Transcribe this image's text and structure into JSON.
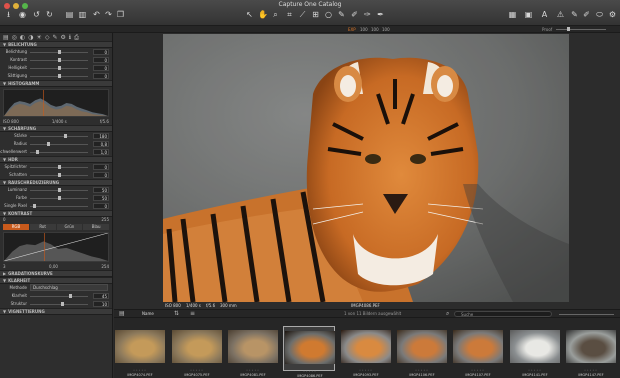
{
  "window": {
    "title": "Capture One Catalog"
  },
  "colors": {
    "accent": "#c85a1c",
    "panel": "#2e2e2e",
    "toolbar": "#3a3a3a"
  },
  "toolbar": {
    "left_icons": [
      "import-icon",
      "capture-icon",
      "rotate-left-icon",
      "rotate-right-icon",
      "folder-icon",
      "copy-icon",
      "undo-icon",
      "redo-icon",
      "stack-icon"
    ],
    "center_icons": [
      "select-icon",
      "pan-icon",
      "zoom-icon",
      "crop-icon",
      "straighten-icon",
      "keystone-icon",
      "spot-icon",
      "picker-icon",
      "brush-icon",
      "eraser-icon",
      "gradient-icon"
    ],
    "right_icons": [
      "grid-icon",
      "proof-icon",
      "text-icon",
      "alert-icon",
      "copy-adjust-icon",
      "apply-adjust-icon",
      "viewer-icon",
      "settings-icon"
    ]
  },
  "viewer_modes": [
    "EXP",
    "100",
    "100",
    "100"
  ],
  "zoom_label": "Proof",
  "sidebar": {
    "sections": {
      "exposure": "BELICHTUNG",
      "histogram": "HISTOGRAMM",
      "sharpening": "SCHÄRFUNG",
      "hdr": "HDR",
      "noise": "RAUSCHREDUZIERUNG",
      "curve": "KONTRAST",
      "gradation": "GRADATIONSKURVE",
      "clarity": "KLARHEIT",
      "vignetting": "VIGNETTIERUNG"
    },
    "exposure_rows": [
      {
        "label": "Belichtung",
        "value": "0",
        "pos": 0.5
      },
      {
        "label": "Kontrast",
        "value": "0",
        "pos": 0.5
      },
      {
        "label": "Helligkeit",
        "value": "0",
        "pos": 0.5
      },
      {
        "label": "Sättigung",
        "value": "0",
        "pos": 0.5
      }
    ],
    "histogram_info": {
      "iso": "ISO 800",
      "shutter": "1/400 s",
      "aperture": "f/5.6"
    },
    "sharpening_rows": [
      {
        "label": "Stärke",
        "value": "180",
        "pos": 0.6
      },
      {
        "label": "Radius",
        "value": "0,8",
        "pos": 0.3
      },
      {
        "label": "Schwellenwert",
        "value": "1,0",
        "pos": 0.1
      }
    ],
    "hdr_rows": [
      {
        "label": "Spitzlichter",
        "value": "0",
        "pos": 0.5
      },
      {
        "label": "Schatten",
        "value": "0",
        "pos": 0.5
      }
    ],
    "noise_rows": [
      {
        "label": "Luminanz",
        "value": "50",
        "pos": 0.5
      },
      {
        "label": "Farbe",
        "value": "50",
        "pos": 0.5
      },
      {
        "label": "Single Pixel",
        "value": "0",
        "pos": 0.05
      }
    ],
    "curve": {
      "input_label": "0",
      "max_label": "255",
      "tabs": [
        "RGB",
        "Rot",
        "Grün",
        "Blau"
      ],
      "bottom_left": "3",
      "bottom_mid": "0,00",
      "bottom_right": "254"
    },
    "clarity": {
      "method_label": "Methode",
      "method_value": "Durchschlag",
      "rows": [
        {
          "label": "Klarheit",
          "value": "45",
          "pos": 0.7
        },
        {
          "label": "Struktur",
          "value": "10",
          "pos": 0.55
        }
      ]
    }
  },
  "viewer": {
    "iso": "ISO 800",
    "shutter": "1/400 s",
    "aperture": "f/5.6",
    "focal": "300 mm",
    "filename": "IMGP4086.PEF"
  },
  "browser": {
    "sort_label": "Name",
    "count_label": "1 von 11 Bildern ausgewählt",
    "search_placeholder": "Suche",
    "thumbnails": [
      {
        "name": "IMGP4074.PEF",
        "kind": "lion"
      },
      {
        "name": "IMGP4075.PEF",
        "kind": "lion"
      },
      {
        "name": "IMGP4081.PEF",
        "kind": "lion-lying"
      },
      {
        "name": "IMGP4086.PEF",
        "kind": "tiger"
      },
      {
        "name": "IMGP4093.PEF",
        "kind": "tiger-side"
      },
      {
        "name": "IMGP4106.PEF",
        "kind": "tiger-lying"
      },
      {
        "name": "IMGP4107.PEF",
        "kind": "tiger-lying"
      },
      {
        "name": "IMGP4141.PEF",
        "kind": "bird"
      },
      {
        "name": "IMGP4147.PEF",
        "kind": "goose"
      }
    ]
  }
}
